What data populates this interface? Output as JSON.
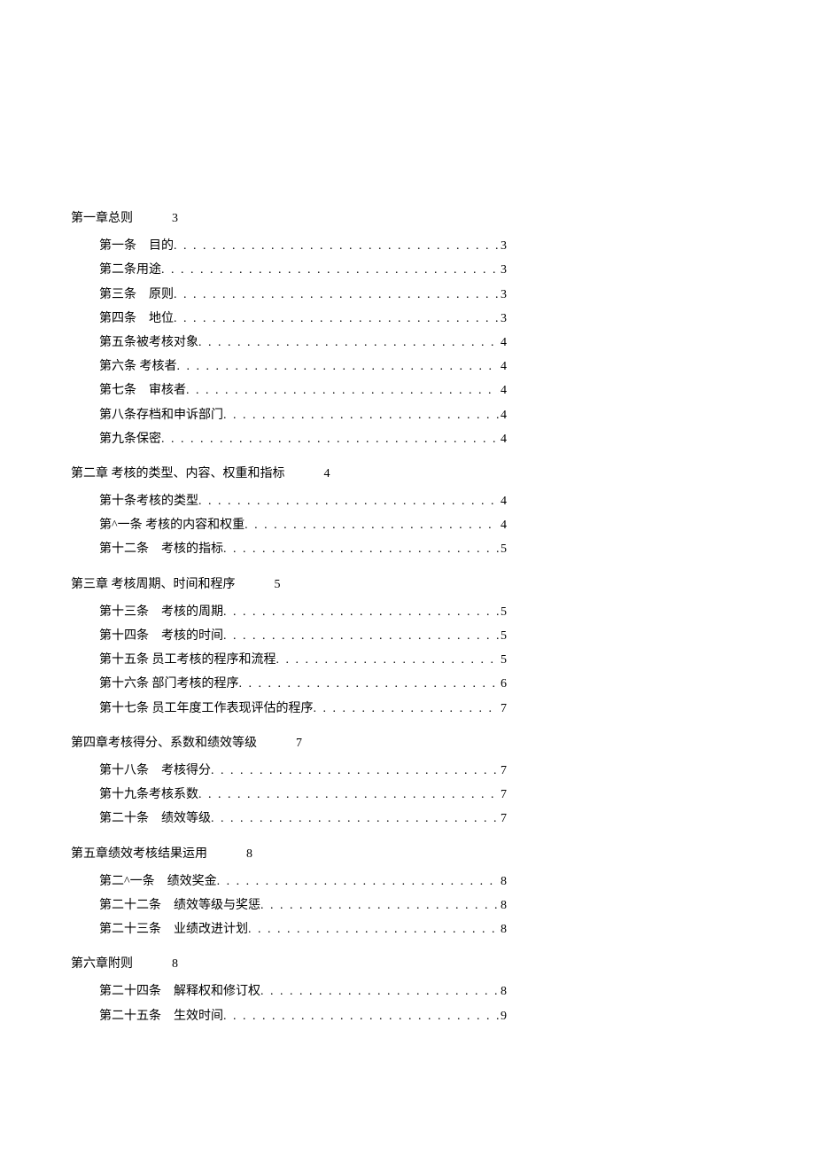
{
  "toc": [
    {
      "title": "第一章总则",
      "page": "3",
      "entries": [
        {
          "label": "第一条　目的",
          "page": "3"
        },
        {
          "label": "第二条用途",
          "page": "3"
        },
        {
          "label": "第三条　原则",
          "page": "3"
        },
        {
          "label": "第四条　地位",
          "page": "3"
        },
        {
          "label": "第五条被考核对象",
          "page": "4"
        },
        {
          "label": "第六条 考核者",
          "page": "4"
        },
        {
          "label": "第七条　审核者",
          "page": "4"
        },
        {
          "label": "第八条存档和申诉部门",
          "page": "4"
        },
        {
          "label": "第九条保密",
          "page": "4"
        }
      ]
    },
    {
      "title": "第二章 考核的类型、内容、权重和指标",
      "page": "4",
      "entries": [
        {
          "label": "第十条考核的类型",
          "page": "4"
        },
        {
          "label": "第^一条 考核的内容和权重",
          "page": "4"
        },
        {
          "label": "第十二条　考核的指标",
          "page": "5"
        }
      ]
    },
    {
      "title": "第三章 考核周期、时间和程序",
      "page": "5",
      "entries": [
        {
          "label": "第十三条　考核的周期",
          "page": "5"
        },
        {
          "label": "第十四条　考核的时间",
          "page": "5"
        },
        {
          "label": "第十五条 员工考核的程序和流程",
          "page": "5"
        },
        {
          "label": "第十六条 部门考核的程序",
          "page": "6"
        },
        {
          "label": "第十七条 员工年度工作表现评估的程序",
          "page": "7"
        }
      ]
    },
    {
      "title": "第四章考核得分、系数和绩效等级",
      "page": "7",
      "entries": [
        {
          "label": "第十八条　考核得分",
          "page": "7"
        },
        {
          "label": "第十九条考核系数",
          "page": "7"
        },
        {
          "label": "第二十条　绩效等级",
          "page": "7"
        }
      ]
    },
    {
      "title": "第五章绩效考核结果运用",
      "page": "8",
      "entries": [
        {
          "label": "第二^一条　绩效奖金",
          "page": "8"
        },
        {
          "label": "第二十二条　绩效等级与奖惩",
          "page": "8"
        },
        {
          "label": "第二十三条　业绩改进计划",
          "page": "8"
        }
      ]
    },
    {
      "title": "第六章附则",
      "page": "8",
      "entries": [
        {
          "label": "第二十四条　解释权和修订权",
          "page": "8"
        },
        {
          "label": "第二十五条　生效时间",
          "page": "9"
        }
      ]
    }
  ],
  "leader": " . . . . . . . . . . . . . . . . . . . . . . . . . . . . . . . . . . . . . . . . . . . . . . . . . . . . . . . . . . . . . ."
}
